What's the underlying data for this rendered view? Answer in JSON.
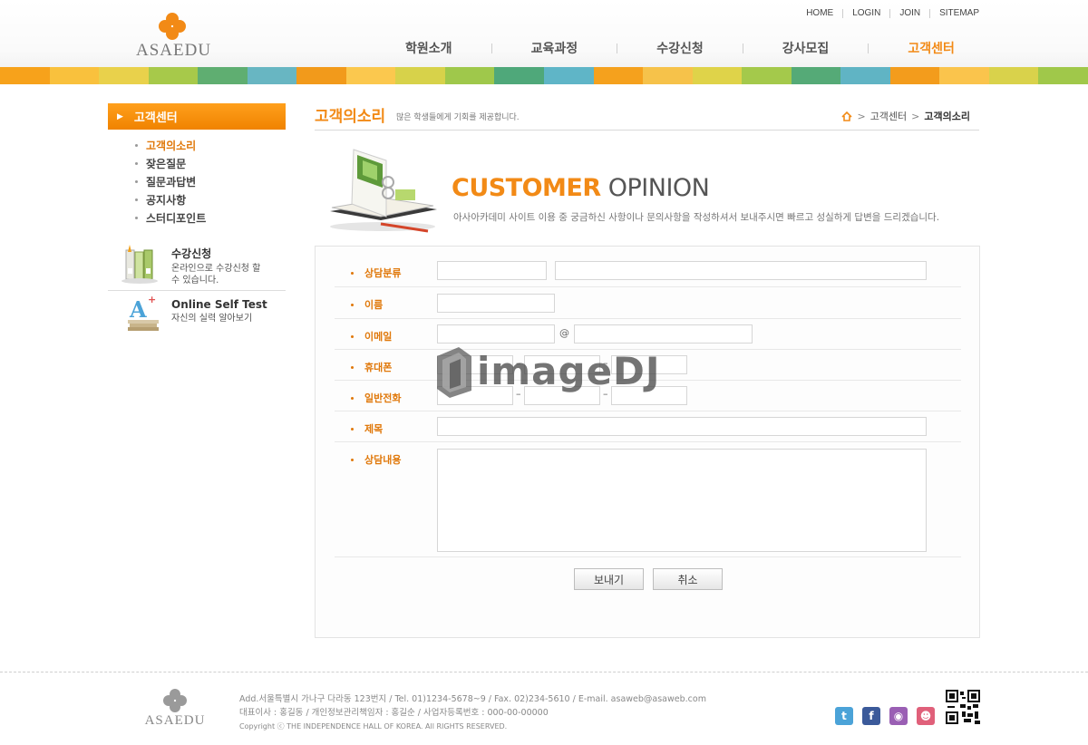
{
  "brand": {
    "logo_text": "ASAEDU",
    "accent": "#f28a16",
    "footer_logo_text": "ASAEDU"
  },
  "util_nav": [
    "HOME",
    "LOGIN",
    "JOIN",
    "SITEMAP"
  ],
  "main_nav": [
    {
      "label": "학원소개",
      "active": false
    },
    {
      "label": "교육과정",
      "active": false
    },
    {
      "label": "수강신청",
      "active": false
    },
    {
      "label": "강사모집",
      "active": false
    },
    {
      "label": "고객센터",
      "active": true
    }
  ],
  "stripe_colors": [
    "#f7a21b",
    "#f9c13d",
    "#e9d14b",
    "#a7c94a",
    "#5fae71",
    "#68b6c2",
    "#f29a1b",
    "#fbc84e",
    "#d7d24a",
    "#9fc84b",
    "#4fa87a",
    "#5fb5c7",
    "#f5a11d",
    "#f6c24a",
    "#dfd349",
    "#a4c94b",
    "#55aa77",
    "#60b4c4",
    "#f39c1c",
    "#fac44c",
    "#d9d24b",
    "#a0c84a"
  ],
  "sidebar": {
    "title": "고객센터",
    "menu": [
      {
        "label": "고객의소리",
        "active": true
      },
      {
        "label": "잦은질문",
        "active": false
      },
      {
        "label": "질문과답변",
        "active": false
      },
      {
        "label": "공지사항",
        "active": false
      },
      {
        "label": "스터디포인트",
        "active": false
      }
    ],
    "banners": [
      {
        "title": "수강신청",
        "desc": "온라인으로 수강신청 할 수 있습니다.",
        "icon": "books-icon"
      },
      {
        "title": "Online Self Test",
        "desc": "자신의 실력 알아보기",
        "icon": "letter-a-books-icon"
      }
    ]
  },
  "page": {
    "title": "고객의소리",
    "subtitle": "많은 학생들에게 기회를 제공합니다.",
    "breadcrumb": [
      "고객센터",
      "고객의소리"
    ]
  },
  "intro": {
    "title_bold": "CUSTOMER",
    "title_light": "OPINION",
    "desc": "아사아카데미 사이트 이용 중 궁금하신 사항이나 문의사항을 작성하셔서 보내주시면 빠르고 성실하게 답변을 드리겠습니다."
  },
  "form": {
    "category_label": "상담분류",
    "name_label": "이름",
    "email_label": "이메일",
    "email_at": "@",
    "mobile_label": "휴대폰",
    "phone_label": "일반전화",
    "dash": "–",
    "subject_label": "제목",
    "content_label": "상담내용",
    "submit_label": "보내기",
    "cancel_label": "취소"
  },
  "watermark": "imageDJ",
  "footer": {
    "address": "Add.서울특별시 가나구 다라동 123번지  /  Tel. 01)1234-5678~9  /  Fax. 02)234-5610  /  E-mail. asaweb@asaweb.com",
    "info": "대표이사 : 홍길동 / 개인정보관리책임자 : 홍길순 / 사업자등록번호 : 000-00-00000",
    "copyright": "Copyright ⓒ THE INDEPENDENCE HALL OF KOREA. All RIGHTS RESERVED."
  },
  "social": [
    {
      "icon": "twitter-icon",
      "glyph": "t",
      "color": "#4ba3d8"
    },
    {
      "icon": "facebook-icon",
      "glyph": "f",
      "color": "#3b5a9a"
    },
    {
      "icon": "location-pin-icon",
      "glyph": "◉",
      "color": "#9a5fb4"
    },
    {
      "icon": "chat-icon",
      "glyph": "☻",
      "color": "#e0607a"
    }
  ]
}
